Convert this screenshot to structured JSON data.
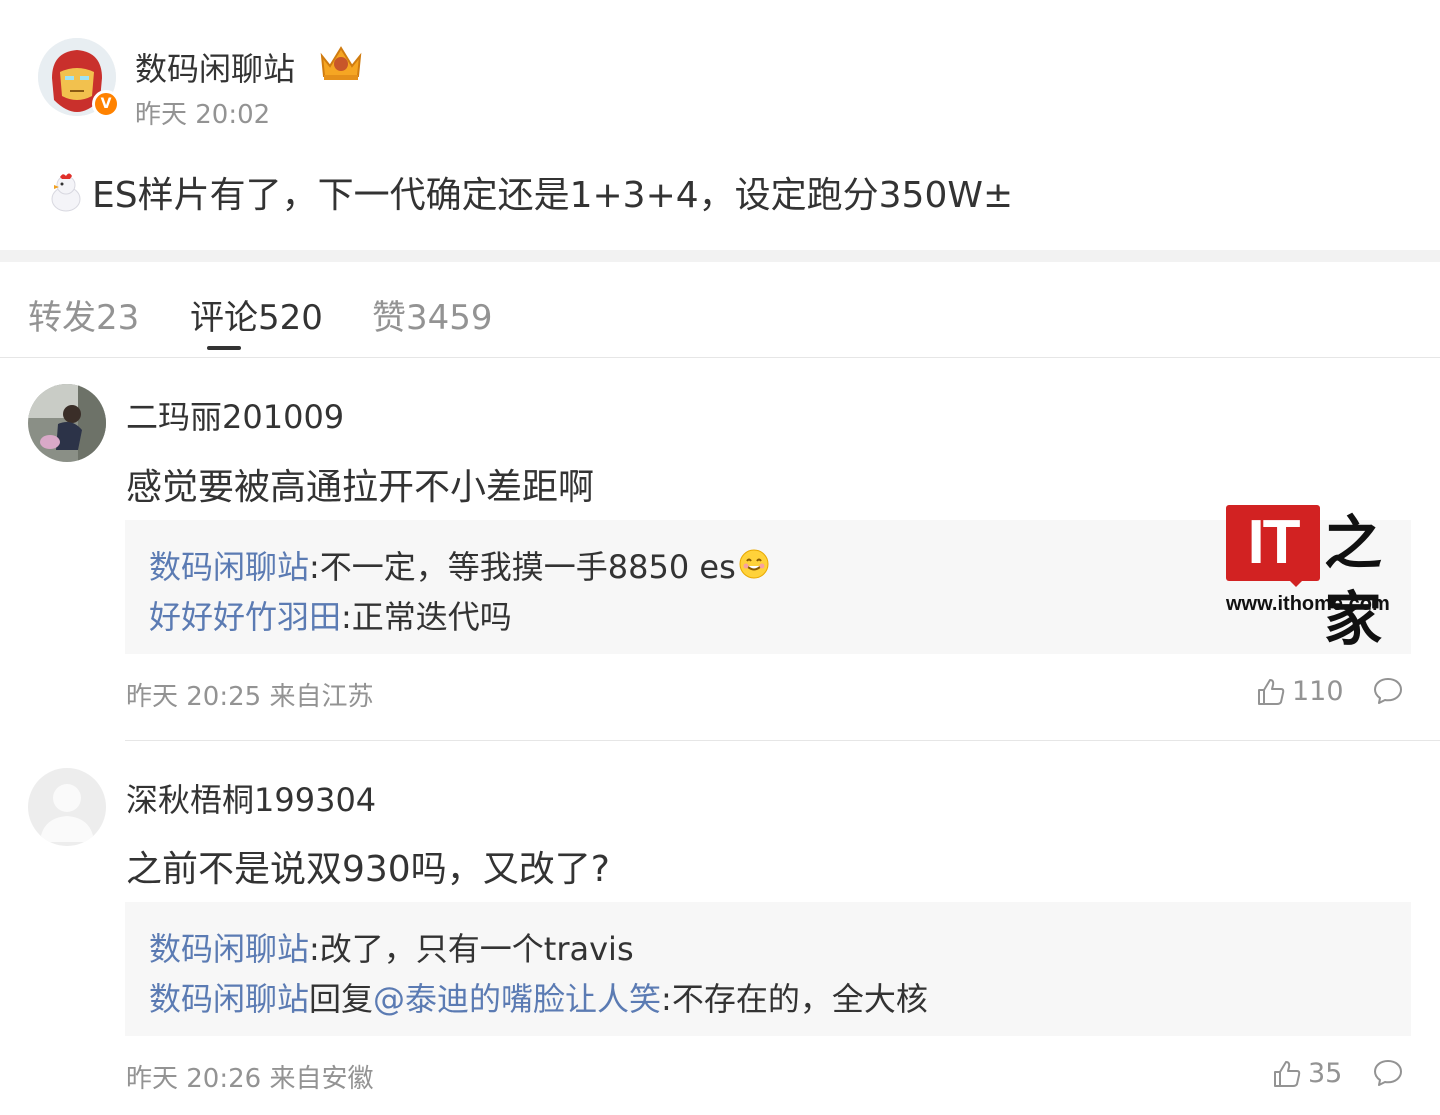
{
  "post": {
    "author": "数码闲聊站",
    "time": "昨天 20:02",
    "text": "ES样片有了，下一代确定还是1+3+4，设定跑分350W±",
    "verified_mark": "V"
  },
  "tabs": [
    {
      "label": "转发23"
    },
    {
      "label": "评论520"
    },
    {
      "label": "赞3459"
    }
  ],
  "comments": [
    {
      "name": "二玛丽201009",
      "text": "感觉要被高通拉开不小差距啊",
      "replies": [
        {
          "author": "数码闲聊站",
          "sep": ":",
          "text": "不一定，等我摸一手8850 es"
        },
        {
          "author": "好好好竹羽田",
          "sep": ":",
          "text": "正常迭代吗"
        }
      ],
      "meta": "昨天 20:25 来自江苏",
      "likes": "110"
    },
    {
      "name": "深秋梧桐199304",
      "text": "之前不是说双930吗，又改了?",
      "replies": [
        {
          "author": "数码闲聊站",
          "sep": ":",
          "text": "改了，只有一个travis"
        },
        {
          "author": "数码闲聊站",
          "mid": "回复",
          "mention": "@泰迪的嘴脸让人笑",
          "sep": ":",
          "text": "不存在的，全大核"
        }
      ],
      "meta": "昨天 20:26 来自安徽",
      "likes": "35"
    }
  ],
  "watermark": {
    "logo": "IT",
    "brand": "之家",
    "url": "www.ithome.com"
  },
  "colors": {
    "link": "#5b7bb3",
    "muted": "#939393",
    "reply_bg": "#f7f7f7",
    "verified": "#ff8200",
    "watermark_red": "#d22222"
  },
  "icons": [
    "chicken-emoji-icon",
    "crown-badge-icon",
    "verified-icon",
    "smile-emoji-icon",
    "thumbs-up-icon",
    "comment-bubble-icon"
  ]
}
